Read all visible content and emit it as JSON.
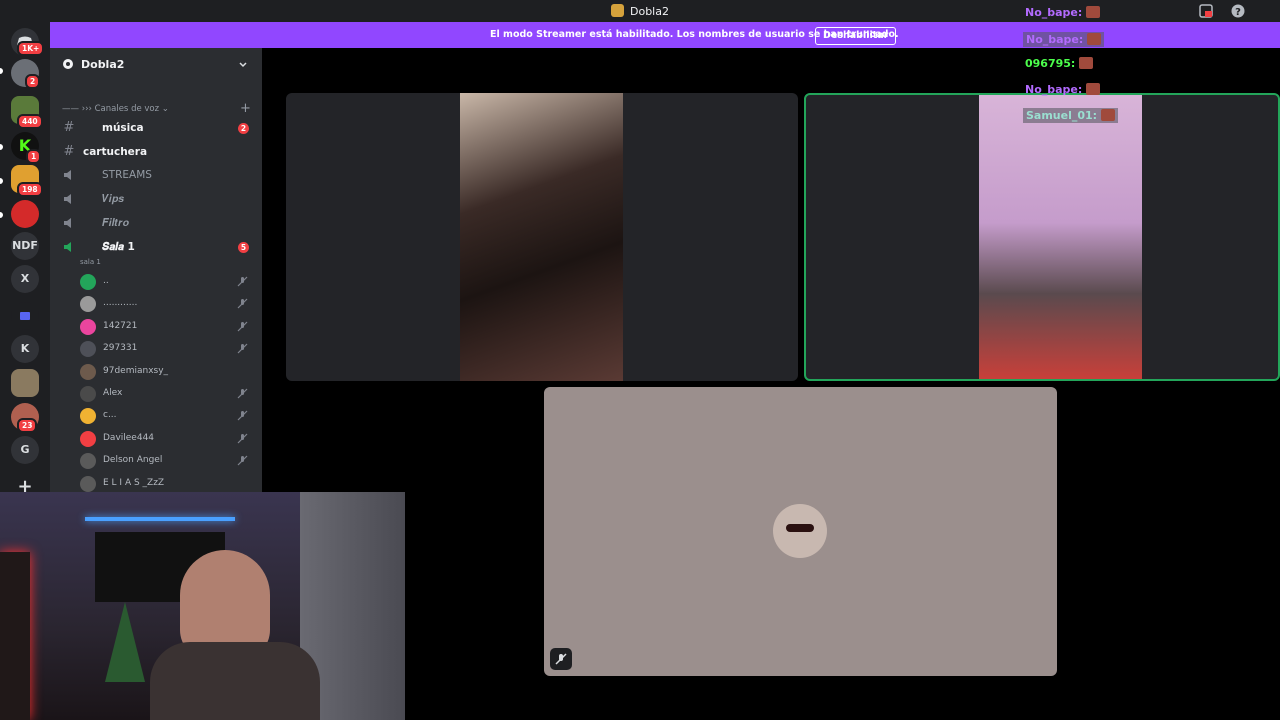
{
  "window": {
    "title": "Dobla2"
  },
  "banner": {
    "text": "El modo Streamer está habilitado. Los nombres de usuario se han truncado.",
    "button_label": "Deshabilitar"
  },
  "rail": {
    "badges": [
      "1K+",
      "2",
      "440",
      "1",
      "198",
      "23"
    ],
    "text_servers": [
      "NDF",
      "X",
      "K",
      "G"
    ]
  },
  "sidebar": {
    "server_name": "Dobla2",
    "category": "—— ››› Canales de voz",
    "channels": [
      {
        "label": "música",
        "badge": "2"
      },
      {
        "label": "cartuchera"
      },
      {
        "label": "STREAMS"
      },
      {
        "label": "𝑽𝒊𝒑𝒔"
      },
      {
        "label": "𝑭𝒊𝒍𝒕𝒓𝒐"
      },
      {
        "label": "𝑺𝒂𝒍𝒂 1",
        "badge": "5",
        "subtitle": "sala 1"
      }
    ],
    "voice_users": [
      {
        "name": "..",
        "color": "#23a55a"
      },
      {
        "name": "............",
        "color": "#9a9a9a"
      },
      {
        "name": "142721",
        "color": "#eb459e"
      },
      {
        "name": "297331",
        "color": "#4e5058"
      },
      {
        "name": "97demianxsy_",
        "color": "#6d5a4c"
      },
      {
        "name": "Alex",
        "color": "#4a4a4a"
      },
      {
        "name": "c...",
        "color": "#f0b232"
      },
      {
        "name": "Davilee444",
        "color": "#f23f43"
      },
      {
        "name": "Delson Angel",
        "color": "#5a5a5a"
      },
      {
        "name": "E L I A S _ZzZ",
        "color": "#5a5a5a"
      }
    ]
  },
  "chat": [
    {
      "user": "No_bape:",
      "color": "#b36bff"
    },
    {
      "user": "No_bape:",
      "color": "#b36bff"
    },
    {
      "user": "096795:",
      "color": "#4cff4c"
    },
    {
      "user": "No_bape:",
      "color": "#b36bff"
    },
    {
      "user": "Samuel_01:",
      "color": "#9adfd0"
    }
  ],
  "colors": {
    "streamer_banner": "#9147ff",
    "speaking_border": "#23a55a"
  }
}
